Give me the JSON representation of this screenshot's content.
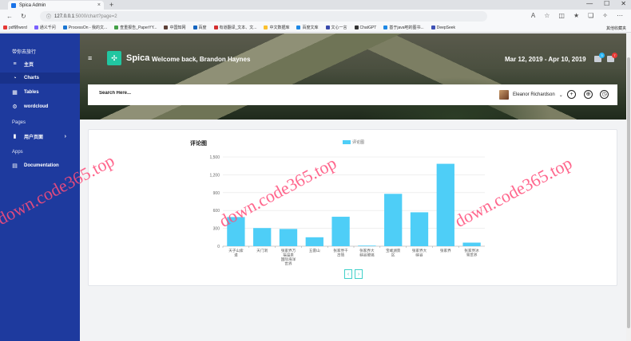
{
  "browser": {
    "tab_title": "Spica Admin",
    "url_host": "127.0.0.1",
    "url_path": ":5000/chart?page=2",
    "bookmarks": [
      "pdf转word",
      "通义千问",
      "ProcessOn - 我的文...",
      "查重报告_PaperYY...",
      "中国知网",
      "百度",
      "有道翻译_文本、文...",
      "中文数据库",
      "百度文库",
      "文心一言",
      "ChatGPT",
      "基于java吧的图书...",
      "DeepSeek"
    ],
    "bookmarks_right": "其他收藏夹"
  },
  "sidebar": {
    "brand": "带你去旅行",
    "items": [
      {
        "label": "主页",
        "icon": "menu-icon"
      },
      {
        "label": "Charts",
        "icon": "pie-chart-icon"
      },
      {
        "label": "Tables",
        "icon": "table-icon"
      },
      {
        "label": "wordcloud",
        "icon": "settings-icon"
      }
    ],
    "section_pages": "Pages",
    "pages_item": "用户页面",
    "section_apps": "Apps",
    "apps_item": "Documentation"
  },
  "header": {
    "logo_text": "Spica",
    "welcome": "Welcome back, Brandon Haynes",
    "date_range": "Mar 12, 2019 - Apr 10, 2019",
    "notif_count": "3",
    "mail_count": "7",
    "search_placeholder": "Search Here...",
    "user_name": "Eleanor Richardson"
  },
  "pager": {
    "prev": "‹",
    "next": "›"
  },
  "chart_data": {
    "type": "bar",
    "title": "评论图",
    "legend": "评论图",
    "categories": [
      "天子山索道",
      "天门洞",
      "张家界万福温泉水世界",
      "五雷山",
      "张家界千古情",
      "张家界大峡谷玻璃桥",
      "宝峰湖景区",
      "张家界大峡谷",
      "张家界",
      "张家界冰雪世界"
    ],
    "category_lines": [
      [
        "天子山索",
        "道"
      ],
      [
        "天门洞"
      ],
      [
        "张家界万",
        "福温泉",
        "国际海洋",
        "世界"
      ],
      [
        "五雷山"
      ],
      [
        "张家界千",
        "古情"
      ],
      [
        "张家界大",
        "峡谷玻璃"
      ],
      [
        "宝峰湖景",
        "区"
      ],
      [
        "张家界大",
        "峡谷"
      ],
      [
        "张家界"
      ],
      [
        "张家界冰",
        "雪世界"
      ]
    ],
    "values": [
      490,
      305,
      290,
      150,
      495,
      10,
      880,
      570,
      1385,
      60
    ],
    "ylim": [
      0,
      1500
    ],
    "yticks": [
      0,
      300,
      600,
      900,
      1200,
      1500
    ],
    "ytick_labels": [
      "0",
      "300",
      "600",
      "900",
      "1,200",
      "1,500"
    ],
    "color": "#4ecef7",
    "grid": true,
    "legend_position": "top"
  },
  "watermark": "down.code365.top"
}
